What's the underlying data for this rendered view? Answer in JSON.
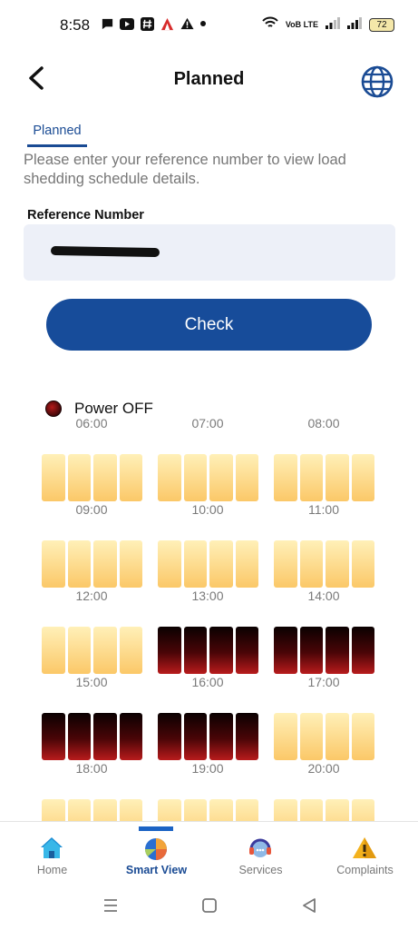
{
  "status_bar": {
    "time": "8:58",
    "icons": [
      "chat-icon",
      "youtube-icon",
      "hashtag-icon",
      "app-icon",
      "warning-icon",
      "dot-icon"
    ],
    "right_icons": [
      "wifi-icon",
      "volte-icon",
      "signal-icon",
      "signal-icon"
    ],
    "volte_text": "VoB LTE",
    "battery": "72"
  },
  "header": {
    "title": "Planned"
  },
  "tabs": [
    {
      "label": "Planned",
      "active": true
    }
  ],
  "instructions": "Please enter your reference number to view load shedding schedule details.",
  "reference": {
    "label": "Reference Number",
    "value": ""
  },
  "check_button": {
    "label": "Check"
  },
  "legend": {
    "label": "Power OFF",
    "color": "#5a0609"
  },
  "colors": {
    "accent": "#174c9a",
    "power_on_top": "#fff0b8",
    "power_on_bottom": "#fbc868",
    "power_off_top": "#0a0101",
    "power_off_bottom": "#b81b1c"
  },
  "schedule": [
    {
      "hour": "06:00",
      "status": "on"
    },
    {
      "hour": "07:00",
      "status": "on"
    },
    {
      "hour": "08:00",
      "status": "on"
    },
    {
      "hour": "09:00",
      "status": "on"
    },
    {
      "hour": "10:00",
      "status": "on"
    },
    {
      "hour": "11:00",
      "status": "on"
    },
    {
      "hour": "12:00",
      "status": "on"
    },
    {
      "hour": "13:00",
      "status": "off"
    },
    {
      "hour": "14:00",
      "status": "off"
    },
    {
      "hour": "15:00",
      "status": "off"
    },
    {
      "hour": "16:00",
      "status": "off"
    },
    {
      "hour": "17:00",
      "status": "on"
    },
    {
      "hour": "18:00",
      "status": "on"
    },
    {
      "hour": "19:00",
      "status": "on"
    },
    {
      "hour": "20:00",
      "status": "on"
    }
  ],
  "bottom_nav": [
    {
      "label": "Home",
      "icon": "home-icon",
      "active": false
    },
    {
      "label": "Smart View",
      "icon": "pie-chart-icon",
      "active": true
    },
    {
      "label": "Services",
      "icon": "headset-icon",
      "active": false
    },
    {
      "label": "Complaints",
      "icon": "warning-icon",
      "active": false
    }
  ]
}
